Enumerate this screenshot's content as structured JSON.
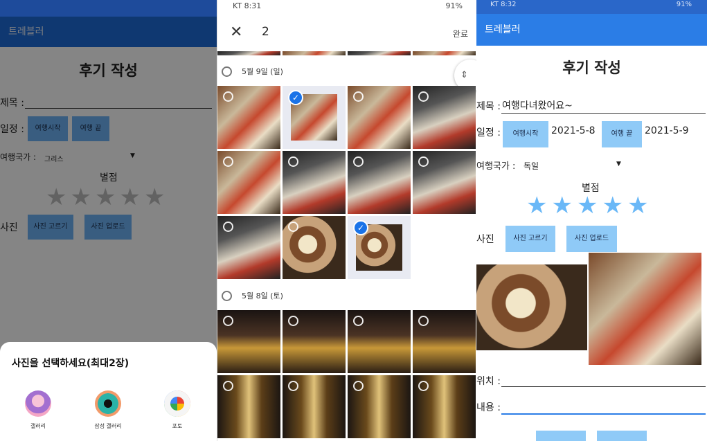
{
  "panel1": {
    "app_title": "트레블러",
    "page_title": "후기 작성",
    "title_label": "제목 :",
    "schedule_label": "일정 :",
    "trip_start_btn": "여행시작",
    "trip_end_btn": "여행 끝",
    "country_label": "여행국가 :",
    "country_value": "그리스",
    "rating_label": "별점",
    "photo_label": "사진",
    "view_photo_btn": "사진 고르기",
    "upload_photo_btn": "사진 업로드",
    "sheet_title": "사진을 선택하세요(최대2장)",
    "sheet_apps": [
      {
        "name": "갤러리",
        "icon": "gallery-icon"
      },
      {
        "name": "삼성 갤러리",
        "icon": "camera-icon"
      },
      {
        "name": "포토",
        "icon": "photos-icon"
      }
    ]
  },
  "panel2": {
    "status_left": "KT 8:31",
    "status_right": "91%",
    "selected_count": "2",
    "done_label": "완료",
    "section1_date": "5월 9일 (일)",
    "section2_date": "5월 8일 (토)"
  },
  "panel3": {
    "status_left": "KT 8:32",
    "status_right": "91%",
    "app_title": "트레블러",
    "page_title": "후기 작성",
    "title_label": "제목 :",
    "title_value": "여행다녀왔어요~",
    "schedule_label": "일정 :",
    "trip_start_btn": "여행시작",
    "start_date": "2021-5-8",
    "trip_end_btn": "여행 끝",
    "end_date": "2021-5-9",
    "country_label": "여행국가 :",
    "country_value": "독일",
    "rating_label": "별점",
    "rating": 5,
    "photo_label": "사진",
    "view_photo_btn": "사진 고르기",
    "upload_photo_btn": "사진 업로드",
    "location_label": "위치 :",
    "content_label": "내용 :"
  },
  "colors": {
    "accent": "#2b7de6",
    "button": "#8fcaf7",
    "star_active": "#6ab8f7",
    "check": "#1a73e8"
  }
}
